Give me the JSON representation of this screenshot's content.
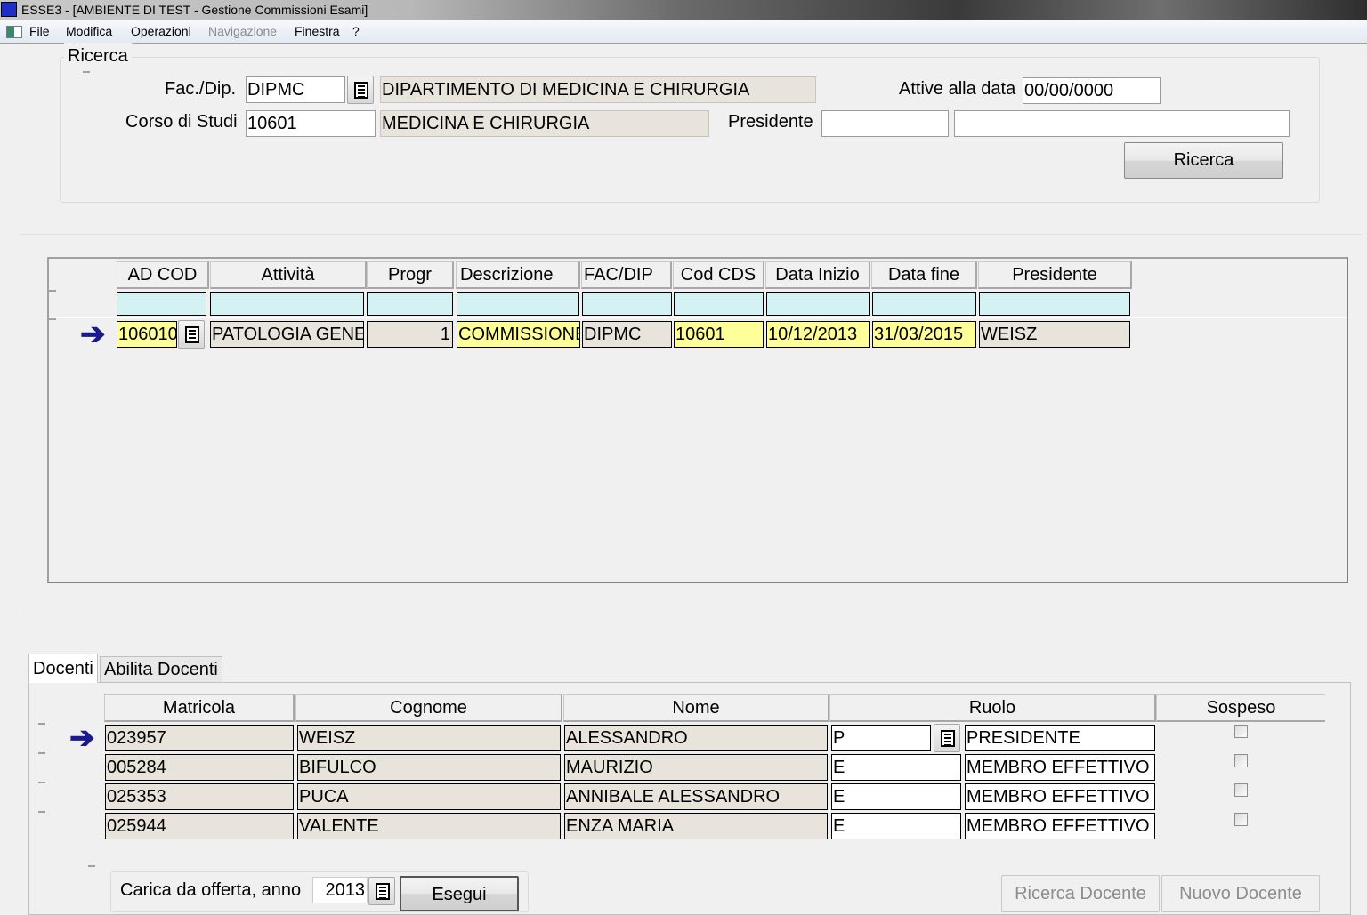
{
  "window": {
    "title": "ESSE3 - [AMBIENTE DI TEST - Gestione Commissioni Esami]"
  },
  "menu": [
    "File",
    "Modifica",
    "Operazioni",
    "Navigazione",
    "Finestra",
    "?"
  ],
  "search": {
    "group_label": "Ricerca",
    "fac_label": "Fac./Dip.",
    "fac_value": "DIPMC",
    "fac_desc": "DIPARTIMENTO DI MEDICINA E CHIRURGIA",
    "date_label": "Attive alla data",
    "date_value": "00/00/0000",
    "cds_label": "Corso di Studi",
    "cds_value": "10601",
    "cds_desc": "MEDICINA E CHIRURGIA",
    "pres_label": "Presidente",
    "pres_value": "",
    "pres_desc": "",
    "search_button": "Ricerca"
  },
  "commissions": {
    "columns": [
      "AD COD",
      "Attività",
      "Progr",
      "Descrizione",
      "FAC/DIP",
      "Cod CDS",
      "Data Inizio",
      "Data fine",
      "Presidente"
    ],
    "rows": [
      {
        "ad_cod": "106010",
        "attivita": "PATOLOGIA GENE",
        "progr": "1",
        "descrizione": "COMMISSIONE",
        "fac_dip": "DIPMC",
        "cod_cds": "10601",
        "data_inizio": "10/12/2013",
        "data_fine": "31/03/2015",
        "presidente": "WEISZ"
      }
    ]
  },
  "tabs": [
    {
      "label": "Docenti",
      "active": true
    },
    {
      "label": "Abilita Docenti",
      "active": false
    }
  ],
  "docenti": {
    "columns": [
      "Matricola",
      "Cognome",
      "Nome",
      "Ruolo",
      "Sospeso"
    ],
    "rows": [
      {
        "matricola": "023957",
        "cognome": "WEISZ",
        "nome": "ALESSANDRO",
        "ruolo_cod": "P",
        "ruolo_desc": "PRESIDENTE",
        "sospeso": false
      },
      {
        "matricola": "005284",
        "cognome": "BIFULCO",
        "nome": "MAURIZIO",
        "ruolo_cod": "E",
        "ruolo_desc": "MEMBRO EFFETTIVO",
        "sospeso": false
      },
      {
        "matricola": "025353",
        "cognome": "PUCA",
        "nome": "ANNIBALE ALESSANDRO",
        "ruolo_cod": "E",
        "ruolo_desc": "MEMBRO EFFETTIVO",
        "sospeso": false
      },
      {
        "matricola": "025944",
        "cognome": "VALENTE",
        "nome": "ENZA MARIA",
        "ruolo_cod": "E",
        "ruolo_desc": "MEMBRO EFFETTIVO",
        "sospeso": false
      }
    ]
  },
  "carica": {
    "label": "Carica da offerta, anno",
    "year": "2013",
    "execute_button": "Esegui"
  },
  "buttons": {
    "ricerca_docente": "Ricerca Docente",
    "nuovo_docente": "Nuovo Docente"
  }
}
